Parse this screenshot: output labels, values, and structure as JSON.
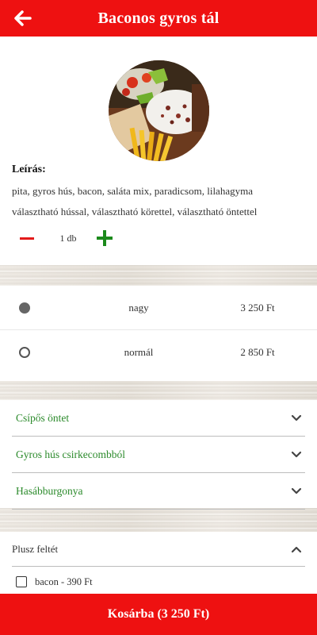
{
  "header": {
    "title": "Baconos gyros tál",
    "back_icon": "arrow-left-icon"
  },
  "product": {
    "image_icon": "food-photo",
    "description_title": "Leírás:",
    "description_lines": [
      "pita, gyros hús, bacon, saláta mix, paradicsom, lilahagyma",
      "választható hússal, választható körettel, választható öntettel"
    ],
    "quantity": "1 db"
  },
  "sizes": [
    {
      "name": "nagy",
      "price": "3 250 Ft",
      "selected": true
    },
    {
      "name": "normál",
      "price": "2 850 Ft",
      "selected": false
    }
  ],
  "options": [
    {
      "label": "Csípős öntet"
    },
    {
      "label": "Gyros hús csirkecombból"
    },
    {
      "label": "Hasábburgonya"
    }
  ],
  "extras": {
    "title": "Plusz feltét",
    "items": [
      {
        "label": "bacon - 390 Ft",
        "checked": false
      }
    ]
  },
  "cart": {
    "label": "Kosárba (3 250 Ft)"
  },
  "colors": {
    "primary_red": "#ee1111",
    "option_green": "#2b8a2b",
    "plus_green": "#1b8a1b"
  }
}
